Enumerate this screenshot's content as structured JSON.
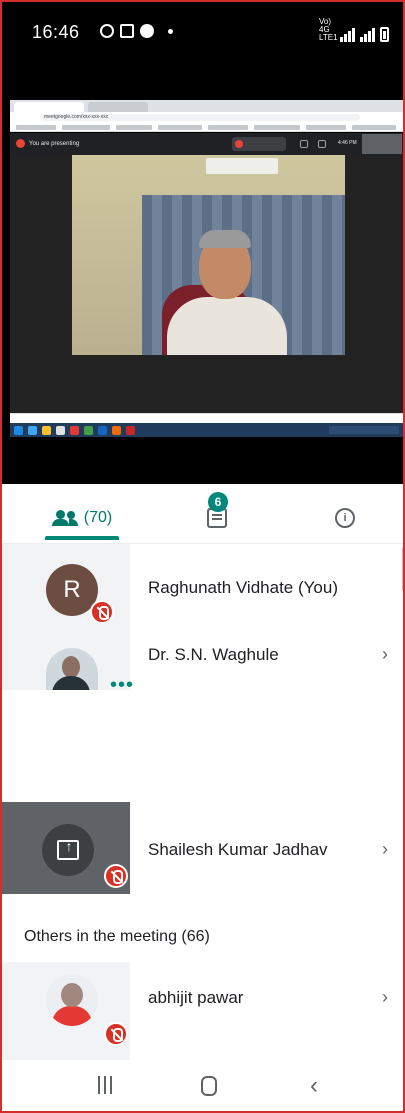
{
  "status_bar": {
    "time": "16:46",
    "network": "Vo) 4G LTE1"
  },
  "video": {
    "presenting_label": "You are presenting",
    "meet_time": "4:46 PM",
    "omnibox_url": "meetgoogle.com/xxx-xxx-xxx"
  },
  "tabs": {
    "people_count": "(70)",
    "chat_badge": "6"
  },
  "participants": [
    {
      "name": "Raghunath Vidhate (You)",
      "avatar_letter": "R",
      "muted": true
    },
    {
      "name": "Dr. S.N. Waghule",
      "muted": false,
      "more": "•••"
    },
    {
      "name": "Shailesh Kumar Jadhav",
      "muted": true,
      "presenting": true
    }
  ],
  "others_header": "Others in the meeting (66)",
  "others": [
    {
      "name": "abhijit pawar",
      "muted": true
    }
  ],
  "chevron": "›",
  "nav": {
    "back": "‹"
  },
  "colors": {
    "accent": "#00897b",
    "mute_red": "#d93025",
    "frame_border": "#d32f2f"
  }
}
